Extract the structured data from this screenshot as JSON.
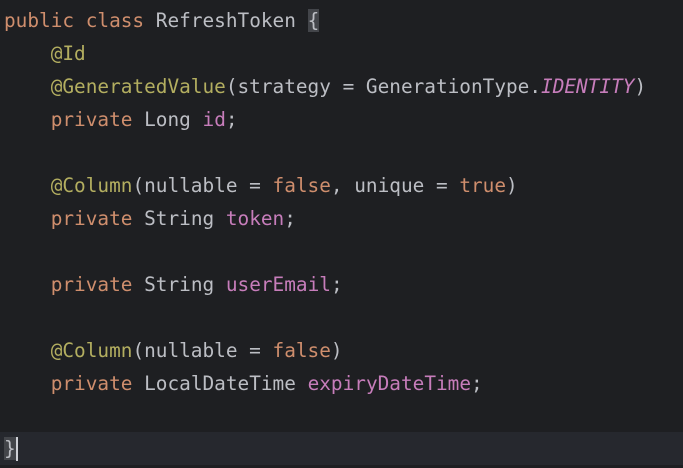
{
  "editor": {
    "lines": [
      {
        "kw_public": "public",
        "kw_class": "class",
        "class_name": "RefreshToken",
        "open_brace": "{"
      },
      {
        "annotation": "@Id"
      },
      {
        "annotation": "@GeneratedValue",
        "args_open": "(strategy = GenerationType.",
        "enum_value": "IDENTITY",
        "args_close": ")"
      },
      {
        "kw_private": "private",
        "type": "Long",
        "field": "id",
        "semicolon": ";"
      },
      {},
      {
        "annotation": "@Column",
        "args_open": "(nullable = ",
        "value1": "false",
        "args_mid": ", unique = ",
        "value2": "true",
        "args_close": ")"
      },
      {
        "kw_private": "private",
        "type": "String",
        "field": "token",
        "semicolon": ";"
      },
      {},
      {
        "kw_private": "private",
        "type": "String",
        "field": "userEmail",
        "semicolon": ";"
      },
      {},
      {
        "annotation": "@Column",
        "args_open": "(nullable = ",
        "value1": "false",
        "args_close": ")"
      },
      {
        "kw_private": "private",
        "type": "LocalDateTime",
        "field": "expiryDateTime",
        "semicolon": ";"
      },
      {},
      {
        "close_brace": "}"
      }
    ],
    "colors": {
      "background": "#1e1f22",
      "current_line": "#26282e",
      "keyword": "#cf8e6d",
      "annotation": "#b3ae60",
      "field": "#c77dbb",
      "text": "#bcbec4"
    }
  }
}
